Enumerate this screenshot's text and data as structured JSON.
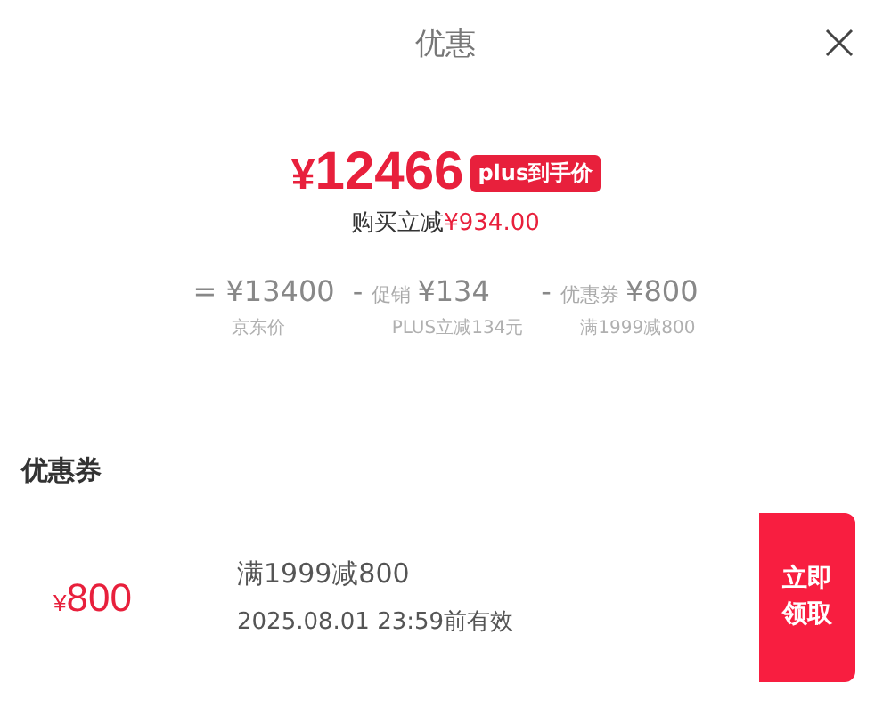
{
  "header": {
    "title": "优惠"
  },
  "price": {
    "currency": "¥",
    "amount": "12466",
    "badge": "plus到手价",
    "saving_label": "购买立减",
    "saving_amount": "¥934.00"
  },
  "breakdown": [
    {
      "op": "=",
      "value": "¥13400",
      "note": "京东价"
    },
    {
      "op": "-",
      "label": "促销",
      "value": "¥134",
      "note": "PLUS立减134元"
    },
    {
      "op": "-",
      "label": "优惠券",
      "value": "¥800",
      "note": "满1999减800"
    }
  ],
  "section_title": "优惠券",
  "coupons": [
    {
      "currency": "¥",
      "amount": "800",
      "condition": "满1999减800",
      "validity": "2025.08.01 23:59前有效",
      "button": [
        "立即",
        "领取"
      ]
    }
  ]
}
